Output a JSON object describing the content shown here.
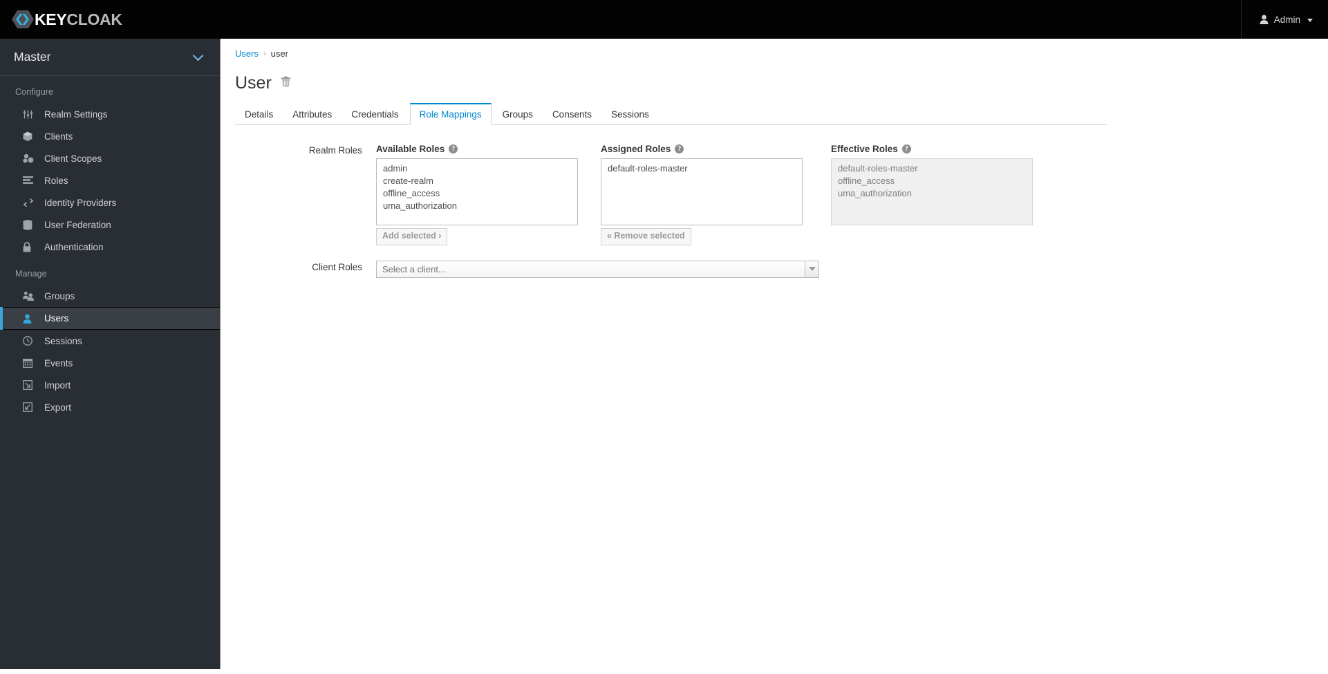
{
  "masthead": {
    "brand_primary": "KEY",
    "brand_secondary": "CLOAK",
    "logo_icon": "keycloak-hexagon-logo",
    "user_icon": "user-avatar-icon",
    "user_label": "Admin",
    "caret_icon": "chevron-down-icon"
  },
  "sidebar": {
    "realm": {
      "name": "Master",
      "chevron_icon": "chevron-down-icon"
    },
    "sections": [
      {
        "title": "Configure",
        "items": [
          {
            "label": "Realm Settings",
            "icon": "sliders-icon",
            "active": false
          },
          {
            "label": "Clients",
            "icon": "cube-icon",
            "active": false
          },
          {
            "label": "Client Scopes",
            "icon": "cubes-icon",
            "active": false
          },
          {
            "label": "Roles",
            "icon": "list-bars-icon",
            "active": false
          },
          {
            "label": "Identity Providers",
            "icon": "exchange-arrows-icon",
            "active": false
          },
          {
            "label": "User Federation",
            "icon": "database-icon",
            "active": false
          },
          {
            "label": "Authentication",
            "icon": "lock-icon",
            "active": false
          }
        ]
      },
      {
        "title": "Manage",
        "items": [
          {
            "label": "Groups",
            "icon": "group-users-icon",
            "active": false
          },
          {
            "label": "Users",
            "icon": "user-icon",
            "active": true
          },
          {
            "label": "Sessions",
            "icon": "clock-icon",
            "active": false
          },
          {
            "label": "Events",
            "icon": "calendar-icon",
            "active": false
          },
          {
            "label": "Import",
            "icon": "import-arrow-icon",
            "active": false
          },
          {
            "label": "Export",
            "icon": "export-arrow-icon",
            "active": false
          }
        ]
      }
    ]
  },
  "content": {
    "breadcrumb": {
      "parent": "Users",
      "separator": "›",
      "current": "user"
    },
    "page_title": "User",
    "delete_icon": "trash-icon",
    "tabs": [
      {
        "label": "Details",
        "active": false
      },
      {
        "label": "Attributes",
        "active": false
      },
      {
        "label": "Credentials",
        "active": false
      },
      {
        "label": "Role Mappings",
        "active": true
      },
      {
        "label": "Groups",
        "active": false
      },
      {
        "label": "Consents",
        "active": false
      },
      {
        "label": "Sessions",
        "active": false
      }
    ],
    "realm_roles": {
      "row_label": "Realm Roles",
      "available": {
        "title": "Available Roles",
        "help_icon": "help-circle-icon",
        "options": [
          "admin",
          "create-realm",
          "offline_access",
          "uma_authorization"
        ],
        "button_label": "Add selected ›"
      },
      "assigned": {
        "title": "Assigned Roles",
        "help_icon": "help-circle-icon",
        "options": [
          "default-roles-master"
        ],
        "button_label": "« Remove selected"
      },
      "effective": {
        "title": "Effective Roles",
        "help_icon": "help-circle-icon",
        "options": [
          "default-roles-master",
          "offline_access",
          "uma_authorization"
        ]
      }
    },
    "client_roles": {
      "row_label": "Client Roles",
      "placeholder": "Select a client...",
      "value": "",
      "dropdown_icon": "triangle-down-icon"
    }
  },
  "colors": {
    "masthead_bg": "#030303",
    "sidebar_bg": "#292e34",
    "active_nav_bg": "#393f44",
    "accent_blue": "#39a5dc",
    "link_blue": "#0088ce"
  }
}
